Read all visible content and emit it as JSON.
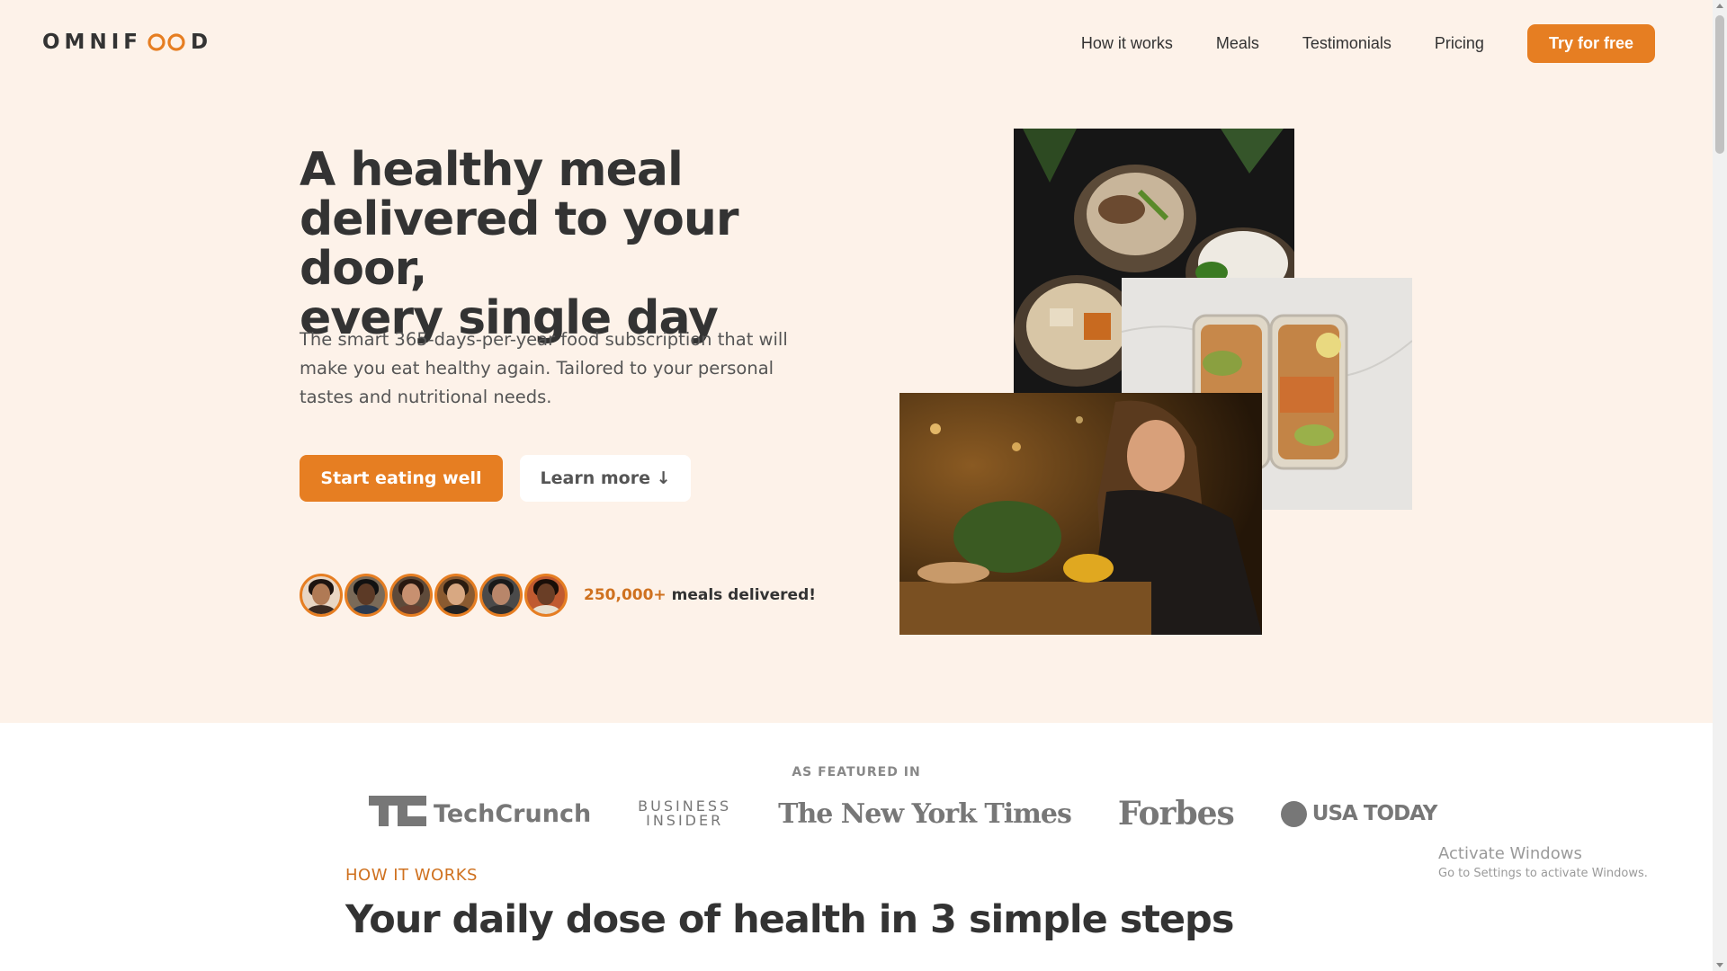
{
  "header": {
    "logo_prefix": "OMNIF",
    "logo_suffix": "D",
    "nav": [
      "How it works",
      "Meals",
      "Testimonials",
      "Pricing"
    ],
    "cta": "Try for free"
  },
  "hero": {
    "title_lines": [
      "A healthy meal",
      "delivered to your door,",
      "every single day"
    ],
    "description": "The smart 365-days-per-year food subscription that will make you eat healthy again. Tailored to your personal tastes and nutritional needs.",
    "primary_button": "Start eating well",
    "secondary_button": "Learn more ↓",
    "delivered_count": "250,000+",
    "delivered_text": " meals delivered!"
  },
  "featured": {
    "label": "AS FEATURED IN",
    "logos": {
      "techcrunch": "TechCrunch",
      "business_insider_1": "BUSINESS",
      "business_insider_2": "INSIDER",
      "nyt": "The New York Times",
      "forbes": "Forbes",
      "usa_today": "USA TODAY"
    }
  },
  "how_it_works": {
    "subheading": "HOW IT WORKS",
    "heading": "Your daily dose of health in 3 simple steps"
  },
  "watermark": {
    "line1": "Activate Windows",
    "line2": "Go to Settings to activate Windows."
  },
  "colors": {
    "accent": "#e67e22",
    "accent_dark": "#cf711f",
    "hero_bg": "#fdf2e9",
    "text": "#333333"
  }
}
